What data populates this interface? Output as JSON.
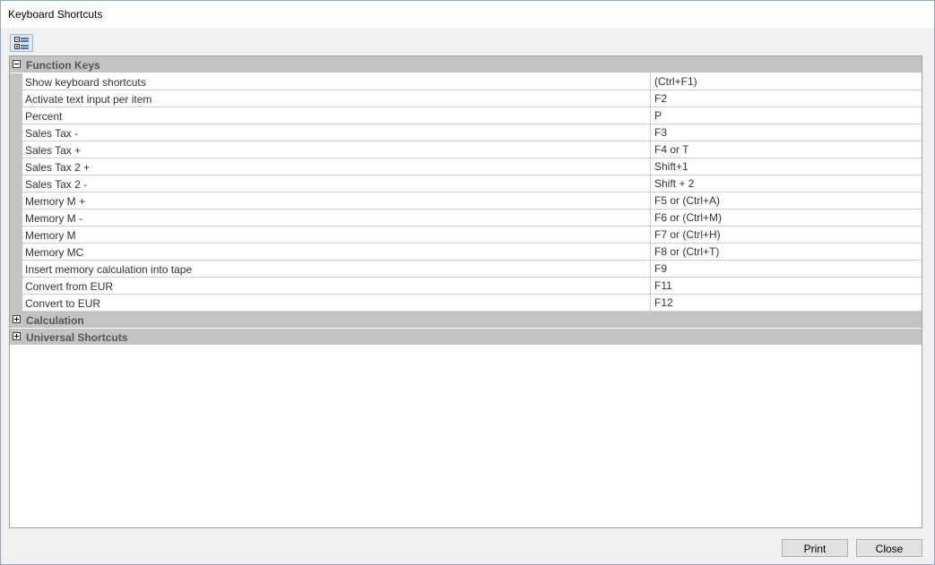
{
  "window": {
    "title": "Keyboard Shortcuts"
  },
  "toolbar": {
    "expand_collapse_icon": "tree-list-icon"
  },
  "groups": [
    {
      "label": "Function Keys",
      "expanded": true,
      "rows": [
        {
          "name": "Show keyboard shortcuts",
          "key": "(Ctrl+F1)"
        },
        {
          "name": "Activate text input per item",
          "key": "F2"
        },
        {
          "name": "Percent",
          "key": "P"
        },
        {
          "name": "Sales Tax -",
          "key": "F3"
        },
        {
          "name": "Sales Tax +",
          "key": "F4 or T"
        },
        {
          "name": "Sales Tax 2 +",
          "key": "Shift+1"
        },
        {
          "name": "Sales Tax 2 -",
          "key": "Shift + 2"
        },
        {
          "name": "Memory M +",
          "key": "F5 or (Ctrl+A)"
        },
        {
          "name": "Memory M -",
          "key": "F6 or (Ctrl+M)"
        },
        {
          "name": "Memory M",
          "key": "F7 or (Ctrl+H)"
        },
        {
          "name": "Memory MC",
          "key": "F8 or (Ctrl+T)"
        },
        {
          "name": "Insert memory calculation into tape",
          "key": "F9"
        },
        {
          "name": "Convert from EUR",
          "key": "F11"
        },
        {
          "name": "Convert to EUR",
          "key": "F12"
        }
      ]
    },
    {
      "label": "Calculation",
      "expanded": false,
      "rows": []
    },
    {
      "label": "Universal Shortcuts",
      "expanded": false,
      "rows": []
    }
  ],
  "footer": {
    "print_label": "Print",
    "close_label": "Close"
  },
  "colors": {
    "group_header": "#c3c3c3",
    "border": "#a0a0a0",
    "toolbar_button": "#dfe8f2"
  }
}
